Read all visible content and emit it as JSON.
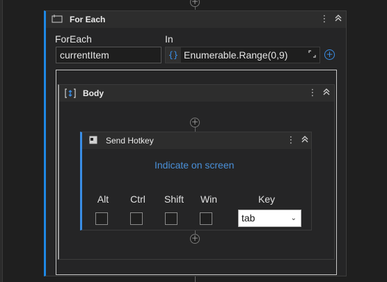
{
  "foreach": {
    "title": "For Each",
    "foreach_label": "ForEach",
    "in_label": "In",
    "item_value": "currentItem",
    "in_expression_tag": "{}",
    "in_expression": "Enumerable.Range(0,9)"
  },
  "body": {
    "title": "Body"
  },
  "send_hotkey": {
    "title": "Send Hotkey",
    "indicate_link": "Indicate on screen",
    "modifiers": [
      {
        "label": "Alt",
        "checked": false
      },
      {
        "label": "Ctrl",
        "checked": false
      },
      {
        "label": "Shift",
        "checked": false
      },
      {
        "label": "Win",
        "checked": false
      }
    ],
    "key_label": "Key",
    "key_value": "tab"
  },
  "icons": {
    "kebab": "⋮",
    "collapse": "⌃",
    "add": "+",
    "expand": "⤡"
  },
  "colors": {
    "accent": "#1e88e5",
    "link": "#4a90d9"
  }
}
